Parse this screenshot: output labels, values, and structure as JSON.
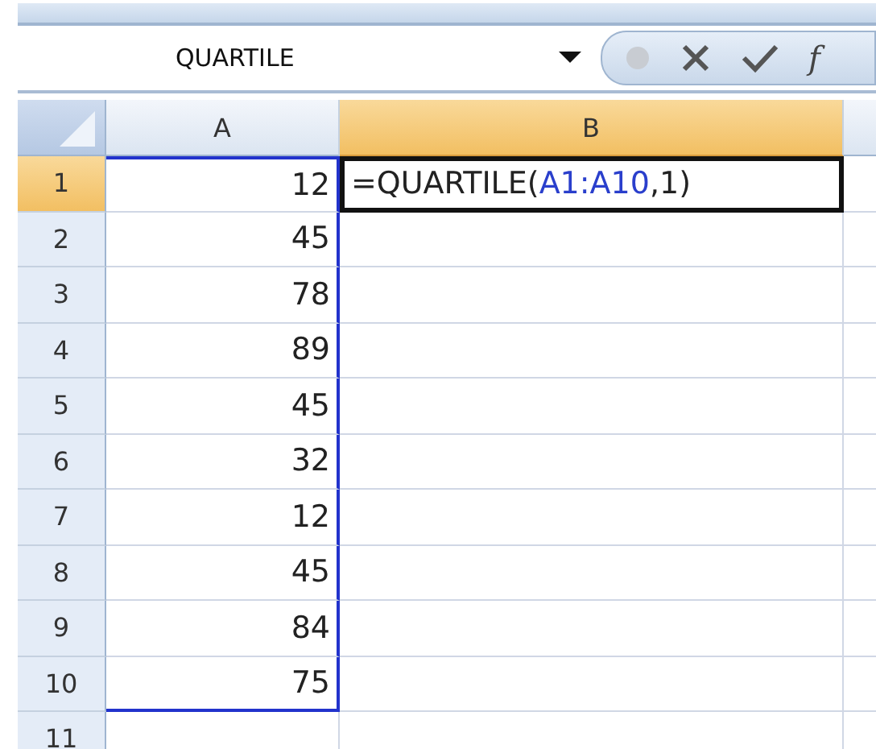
{
  "formula_bar": {
    "name_box": "QUARTILE",
    "function_label": "f"
  },
  "columns": [
    {
      "label": "A",
      "selected": false
    },
    {
      "label": "B",
      "selected": true
    }
  ],
  "rows": [
    {
      "label": "1",
      "selected": true,
      "a": "12",
      "b": [
        {
          "kind": "text",
          "text": "=QUARTILE("
        },
        {
          "kind": "ref",
          "text": "A1:A10"
        },
        {
          "kind": "text",
          "text": ",1)"
        }
      ]
    },
    {
      "label": "2",
      "selected": false,
      "a": "45"
    },
    {
      "label": "3",
      "selected": false,
      "a": "78"
    },
    {
      "label": "4",
      "selected": false,
      "a": "89"
    },
    {
      "label": "5",
      "selected": false,
      "a": "45"
    },
    {
      "label": "6",
      "selected": false,
      "a": "32"
    },
    {
      "label": "7",
      "selected": false,
      "a": "12"
    },
    {
      "label": "8",
      "selected": false,
      "a": "45"
    },
    {
      "label": "9",
      "selected": false,
      "a": "84"
    },
    {
      "label": "10",
      "selected": false,
      "a": "75"
    },
    {
      "label": "11",
      "selected": false,
      "a": ""
    }
  ]
}
